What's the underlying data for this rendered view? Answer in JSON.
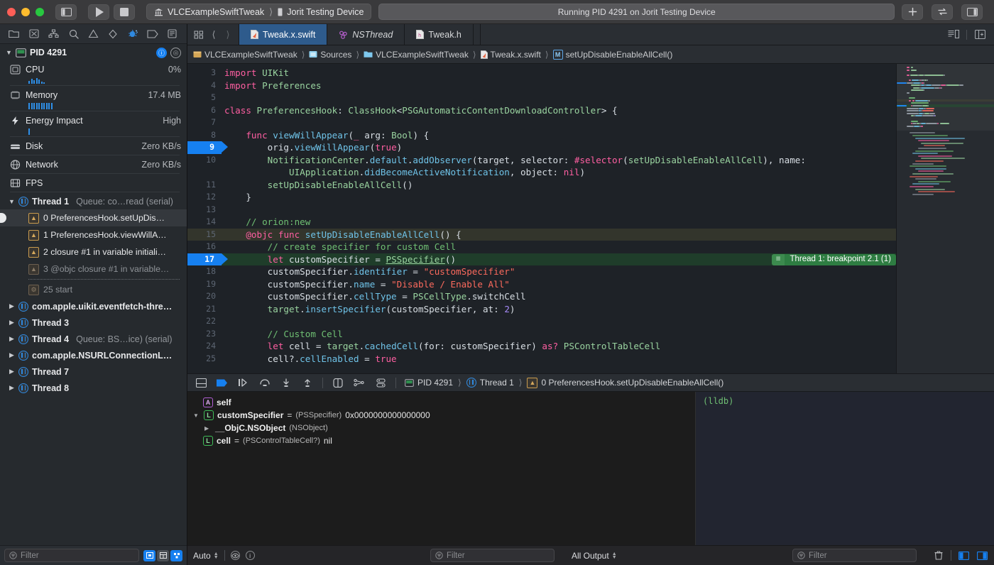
{
  "titlebar": {
    "sidebar_toggle": "sidebar-toggle",
    "run_label": "Run",
    "stop_label": "Stop",
    "scheme": "VLCExampleSwiftTweak",
    "destination": "Jorit Testing Device",
    "status": "Running PID 4291 on Jorit Testing Device",
    "add_label": "+",
    "swap_label": "⇄"
  },
  "navigator": {
    "icons": [
      "folder-icon",
      "source-control-icon",
      "hierarchy-icon",
      "search-icon",
      "warning-icon",
      "test-icon",
      "debug-icon",
      "breakpoint-icon",
      "report-icon"
    ],
    "pid": {
      "label": "PID 4291",
      "info_badge": "i",
      "thread_badge": "t"
    },
    "gauges": [
      {
        "name": "CPU",
        "value": "0%",
        "icon": "cpu-icon",
        "bars": [
          3,
          5,
          4,
          7,
          5,
          3,
          2
        ]
      },
      {
        "name": "Memory",
        "value": "17.4 MB",
        "icon": "memory-icon",
        "bars": [
          9,
          9,
          9,
          9,
          9,
          9,
          9,
          9,
          9,
          9
        ]
      },
      {
        "name": "Energy Impact",
        "value": "High",
        "icon": "energy-icon",
        "bars": [
          9
        ]
      },
      {
        "name": "Disk",
        "value": "Zero KB/s",
        "icon": "disk-icon",
        "bars": []
      },
      {
        "name": "Network",
        "value": "Zero KB/s",
        "icon": "network-icon",
        "bars": []
      },
      {
        "name": "FPS",
        "value": "",
        "icon": "fps-icon",
        "bars": []
      }
    ],
    "threads": [
      {
        "kind": "thread",
        "expanded": true,
        "name": "Thread 1",
        "queue": "Queue: co…read (serial)",
        "frames": [
          {
            "label": "0 PreferencesHook.setUpDis…",
            "selected": true,
            "dim": false,
            "icon": "swift-frame-icon"
          },
          {
            "label": "1 PreferencesHook.viewWillA…",
            "selected": false,
            "dim": false,
            "icon": "swift-frame-icon"
          },
          {
            "label": "2 closure #1 in variable initiali…",
            "selected": false,
            "dim": false,
            "icon": "swift-frame-icon"
          },
          {
            "label": "3 @objc closure #1 in variable…",
            "selected": false,
            "dim": true,
            "icon": "swift-frame-icon"
          },
          {
            "separator": true
          },
          {
            "label": "25 start",
            "selected": false,
            "dim": true,
            "icon": "gear-frame-icon"
          }
        ]
      },
      {
        "kind": "thread",
        "expanded": false,
        "name": "com.apple.uikit.eventfetch-thre…",
        "queue": ""
      },
      {
        "kind": "thread",
        "expanded": false,
        "name": "Thread 3",
        "queue": ""
      },
      {
        "kind": "thread",
        "expanded": false,
        "name": "Thread 4",
        "queue": "Queue: BS…ice) (serial)"
      },
      {
        "kind": "thread",
        "expanded": false,
        "name": "com.apple.NSURLConnectionL…",
        "queue": ""
      },
      {
        "kind": "thread",
        "expanded": false,
        "name": "Thread 7",
        "queue": ""
      },
      {
        "kind": "thread",
        "expanded": false,
        "name": "Thread 8",
        "queue": ""
      }
    ],
    "filter_placeholder": "Filter"
  },
  "editor": {
    "tabs": [
      {
        "label": "Tweak.x.swift",
        "icon": "swift-file-icon",
        "active": true,
        "italic": false
      },
      {
        "label": "NSThread",
        "icon": "objc-symbol-icon",
        "active": false,
        "italic": true
      },
      {
        "label": "Tweak.h",
        "icon": "header-file-icon",
        "active": false,
        "italic": false
      }
    ],
    "breadcrumb": [
      {
        "label": "VLCExampleSwiftTweak",
        "icon": "project-icon"
      },
      {
        "label": "Sources",
        "icon": "folder-blue-icon"
      },
      {
        "label": "VLCExampleSwiftTweak",
        "icon": "folder-blue-icon"
      },
      {
        "label": "Tweak.x.swift",
        "icon": "swift-file-icon"
      },
      {
        "label": "setUpDisableEnableAllCell()",
        "icon": "method-m-icon"
      }
    ],
    "stop_badge": {
      "icon": "lines-icon",
      "text": "Thread 1: breakpoint 2.1 (1)"
    },
    "lines": [
      {
        "n": 3,
        "tokens": [
          [
            "kw",
            "import"
          ],
          [
            "id",
            " "
          ],
          [
            "typ",
            "UIKit"
          ]
        ]
      },
      {
        "n": 4,
        "tokens": [
          [
            "kw",
            "import"
          ],
          [
            "id",
            " "
          ],
          [
            "typ",
            "Preferences"
          ]
        ]
      },
      {
        "n": 5,
        "tokens": []
      },
      {
        "n": 6,
        "tokens": [
          [
            "kw",
            "class"
          ],
          [
            "id",
            " "
          ],
          [
            "typ",
            "PreferencesHook"
          ],
          [
            "id",
            ": "
          ],
          [
            "typ",
            "ClassHook"
          ],
          [
            "id",
            "<"
          ],
          [
            "typ",
            "PSGAutomaticContentDownloadController"
          ],
          [
            "id",
            "> {"
          ]
        ]
      },
      {
        "n": 7,
        "tokens": []
      },
      {
        "n": 8,
        "tokens": [
          [
            "id",
            "    "
          ],
          [
            "kw",
            "func"
          ],
          [
            "id",
            " "
          ],
          [
            "fn",
            "viewWillAppear"
          ],
          [
            "id",
            "("
          ],
          [
            "kw",
            "_"
          ],
          [
            "id",
            " arg: "
          ],
          [
            "typ",
            "Bool"
          ],
          [
            "id",
            ") {"
          ]
        ]
      },
      {
        "n": 9,
        "pc": true,
        "tokens": [
          [
            "id",
            "        orig."
          ],
          [
            "prop",
            "viewWillAppear"
          ],
          [
            "id",
            "("
          ],
          [
            "kw",
            "true"
          ],
          [
            "id",
            ")"
          ]
        ]
      },
      {
        "n": 10,
        "tokens": [
          [
            "id",
            "        "
          ],
          [
            "typ",
            "NotificationCenter"
          ],
          [
            "id",
            "."
          ],
          [
            "prop",
            "default"
          ],
          [
            "id",
            "."
          ],
          [
            "prop",
            "addObserver"
          ],
          [
            "id",
            "(target, selector: "
          ],
          [
            "attr",
            "#selector"
          ],
          [
            "id",
            "("
          ],
          [
            "glob",
            "setUpDisableEnableAllCell"
          ],
          [
            "id",
            "), name:"
          ]
        ]
      },
      {
        "n": null,
        "tokens": [
          [
            "id",
            "            "
          ],
          [
            "typ",
            "UIApplication"
          ],
          [
            "id",
            "."
          ],
          [
            "prop",
            "didBecomeActiveNotification"
          ],
          [
            "id",
            ", object: "
          ],
          [
            "kw",
            "nil"
          ],
          [
            "id",
            ")"
          ]
        ]
      },
      {
        "n": 11,
        "tokens": [
          [
            "id",
            "        "
          ],
          [
            "glob",
            "setUpDisableEnableAllCell"
          ],
          [
            "id",
            "()"
          ]
        ]
      },
      {
        "n": 12,
        "tokens": [
          [
            "id",
            "    }"
          ]
        ]
      },
      {
        "n": 13,
        "tokens": []
      },
      {
        "n": 14,
        "tokens": [
          [
            "id",
            "    "
          ],
          [
            "cmt",
            "// orion:new"
          ]
        ]
      },
      {
        "n": 15,
        "current": true,
        "tokens": [
          [
            "id",
            "    "
          ],
          [
            "attr",
            "@objc"
          ],
          [
            "id",
            " "
          ],
          [
            "kw",
            "func"
          ],
          [
            "id",
            " "
          ],
          [
            "fn",
            "setUpDisableEnableAllCell"
          ],
          [
            "id",
            "() {"
          ]
        ]
      },
      {
        "n": 16,
        "tokens": [
          [
            "id",
            "        "
          ],
          [
            "cmt",
            "// create specifier for custom Cell"
          ]
        ]
      },
      {
        "n": 17,
        "pc": true,
        "stopped": true,
        "badge": true,
        "tokens": [
          [
            "id",
            "        "
          ],
          [
            "kw",
            "let"
          ],
          [
            "id",
            " customSpecifier = "
          ],
          [
            "und typ",
            "PSSpecifier"
          ],
          [
            "id",
            "()"
          ]
        ]
      },
      {
        "n": 18,
        "tokens": [
          [
            "id",
            "        customSpecifier."
          ],
          [
            "prop",
            "identifier"
          ],
          [
            "id",
            " = "
          ],
          [
            "str",
            "\"customSpecifier\""
          ]
        ]
      },
      {
        "n": 19,
        "tokens": [
          [
            "id",
            "        customSpecifier."
          ],
          [
            "prop",
            "name"
          ],
          [
            "id",
            " = "
          ],
          [
            "str",
            "\"Disable / Enable All\""
          ]
        ]
      },
      {
        "n": 20,
        "tokens": [
          [
            "id",
            "        customSpecifier."
          ],
          [
            "prop",
            "cellType"
          ],
          [
            "id",
            " = "
          ],
          [
            "typ",
            "PSCellType"
          ],
          [
            "id",
            ".switchCell"
          ]
        ]
      },
      {
        "n": 21,
        "tokens": [
          [
            "id",
            "        "
          ],
          [
            "glob",
            "target"
          ],
          [
            "id",
            "."
          ],
          [
            "prop",
            "insertSpecifier"
          ],
          [
            "id",
            "(customSpecifier, at: "
          ],
          [
            "num",
            "2"
          ],
          [
            "id",
            ")"
          ]
        ]
      },
      {
        "n": 22,
        "tokens": []
      },
      {
        "n": 23,
        "tokens": [
          [
            "id",
            "        "
          ],
          [
            "cmt",
            "// Custom Cell"
          ]
        ]
      },
      {
        "n": 24,
        "tokens": [
          [
            "id",
            "        "
          ],
          [
            "kw",
            "let"
          ],
          [
            "id",
            " cell = "
          ],
          [
            "glob",
            "target"
          ],
          [
            "id",
            "."
          ],
          [
            "prop",
            "cachedCell"
          ],
          [
            "id",
            "(for: customSpecifier) "
          ],
          [
            "kw",
            "as?"
          ],
          [
            "id",
            " "
          ],
          [
            "typ",
            "PSControlTableCell"
          ]
        ]
      },
      {
        "n": 25,
        "tokens": [
          [
            "id",
            "        cell?."
          ],
          [
            "prop",
            "cellEnabled"
          ],
          [
            "id",
            " = "
          ],
          [
            "kw",
            "true"
          ]
        ]
      }
    ]
  },
  "debug": {
    "toolbar_icons": [
      "hide-debug-area-icon",
      "deactivate-breakpoints-icon",
      "continue-icon",
      "step-over-icon",
      "step-into-icon",
      "step-out-icon",
      "view-debugger-icon",
      "memory-graph-icon",
      "simulate-location-icon"
    ],
    "crumbs": [
      {
        "label": "PID 4291",
        "icon": "process-icon"
      },
      {
        "label": "Thread 1",
        "icon": "thread-icon"
      },
      {
        "label": "0 PreferencesHook.setUpDisableEnableAllCell()",
        "icon": "swift-frame-icon"
      }
    ],
    "variables": [
      {
        "indent": 0,
        "tri": "none",
        "chip": "A",
        "name": "self",
        "eq": "",
        "type": "",
        "value": ""
      },
      {
        "indent": 0,
        "tri": "down",
        "chip": "L",
        "name": "customSpecifier",
        "eq": "=",
        "type": "(PSSpecifier)",
        "value": "0x0000000000000000"
      },
      {
        "indent": 1,
        "tri": "right",
        "chip": "",
        "name": "__ObjC.NSObject",
        "eq": "",
        "type": "(NSObject)",
        "value": ""
      },
      {
        "indent": 0,
        "tri": "none",
        "chip": "L",
        "name": "cell",
        "eq": "=",
        "type": "(PSControlTableCell?)",
        "value": "nil"
      }
    ],
    "console_text": "(lldb)",
    "scope_popup": "Auto",
    "eye_icon": "eye-icon",
    "info_icon": "info-icon",
    "vars_filter_placeholder": "Filter",
    "output_popup": "All Output",
    "console_filter_placeholder": "Filter",
    "trash_icon": "trash-icon"
  },
  "colors": {
    "accent_blue": "#1680f0",
    "stop_green": "#2e7d42",
    "tab_active": "#2e5b8c",
    "editor_bg": "#1e2227"
  }
}
